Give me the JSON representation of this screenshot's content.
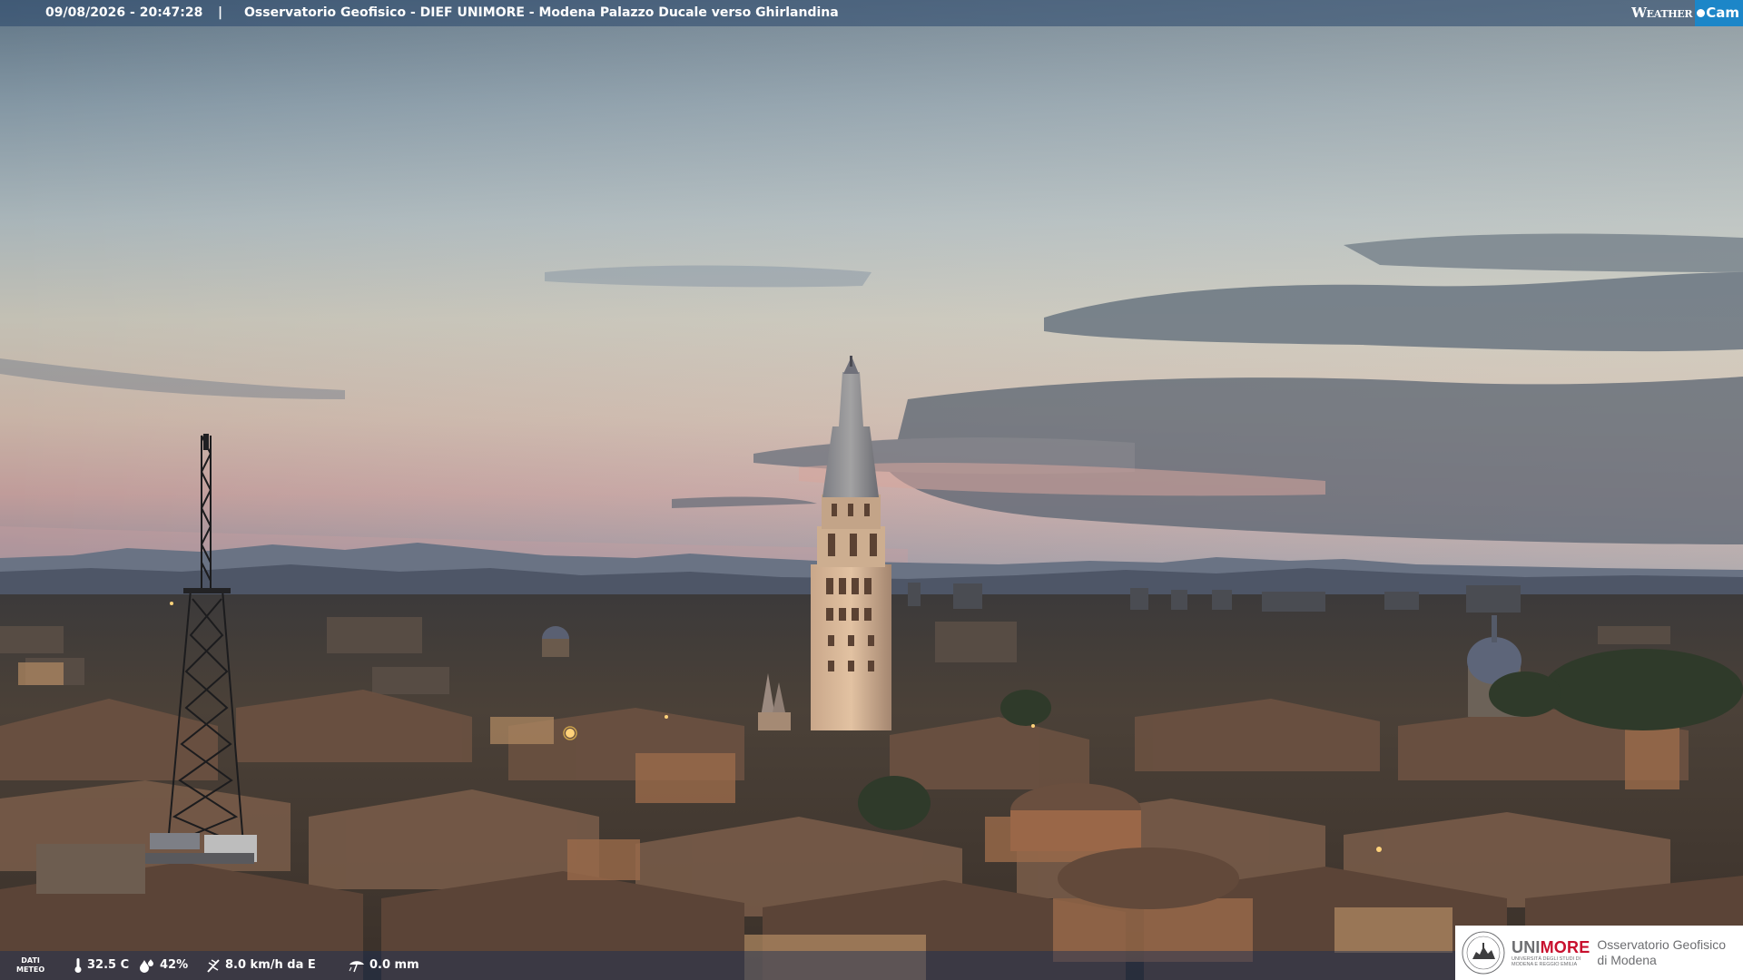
{
  "header": {
    "datetime": "09/08/2026 - 20:47:28",
    "separator": "|",
    "camera_title": "Osservatorio Geofisico - DIEF UNIMORE - Modena Palazzo Ducale verso Ghirlandina"
  },
  "brand": {
    "weather": "Weather",
    "cam": "Cam"
  },
  "weather_bar": {
    "label_line1": "DATI",
    "label_line2": "METEO",
    "temperature": "32.5 C",
    "humidity": "42%",
    "wind": "8.0 km/h da E",
    "rain": "0.0 mm"
  },
  "logo": {
    "uni_part1": "UNI",
    "uni_part2": "MORE",
    "uni_sub_line1": "UNIVERSITÀ DEGLI STUDI DI",
    "uni_sub_line2": "MODENA E REGGIO EMILIA",
    "observatory_line1": "Osservatorio Geofisico",
    "observatory_line2": "di Modena"
  },
  "icons": {
    "temperature": "thermometer-icon",
    "humidity": "droplets-icon",
    "wind": "wind-direction-icon",
    "rain": "rain-gauge-icon"
  },
  "colors": {
    "brand_cam": "#1c86c8",
    "unimore_red": "#c8102e",
    "unimore_gray": "#6d6e71"
  }
}
